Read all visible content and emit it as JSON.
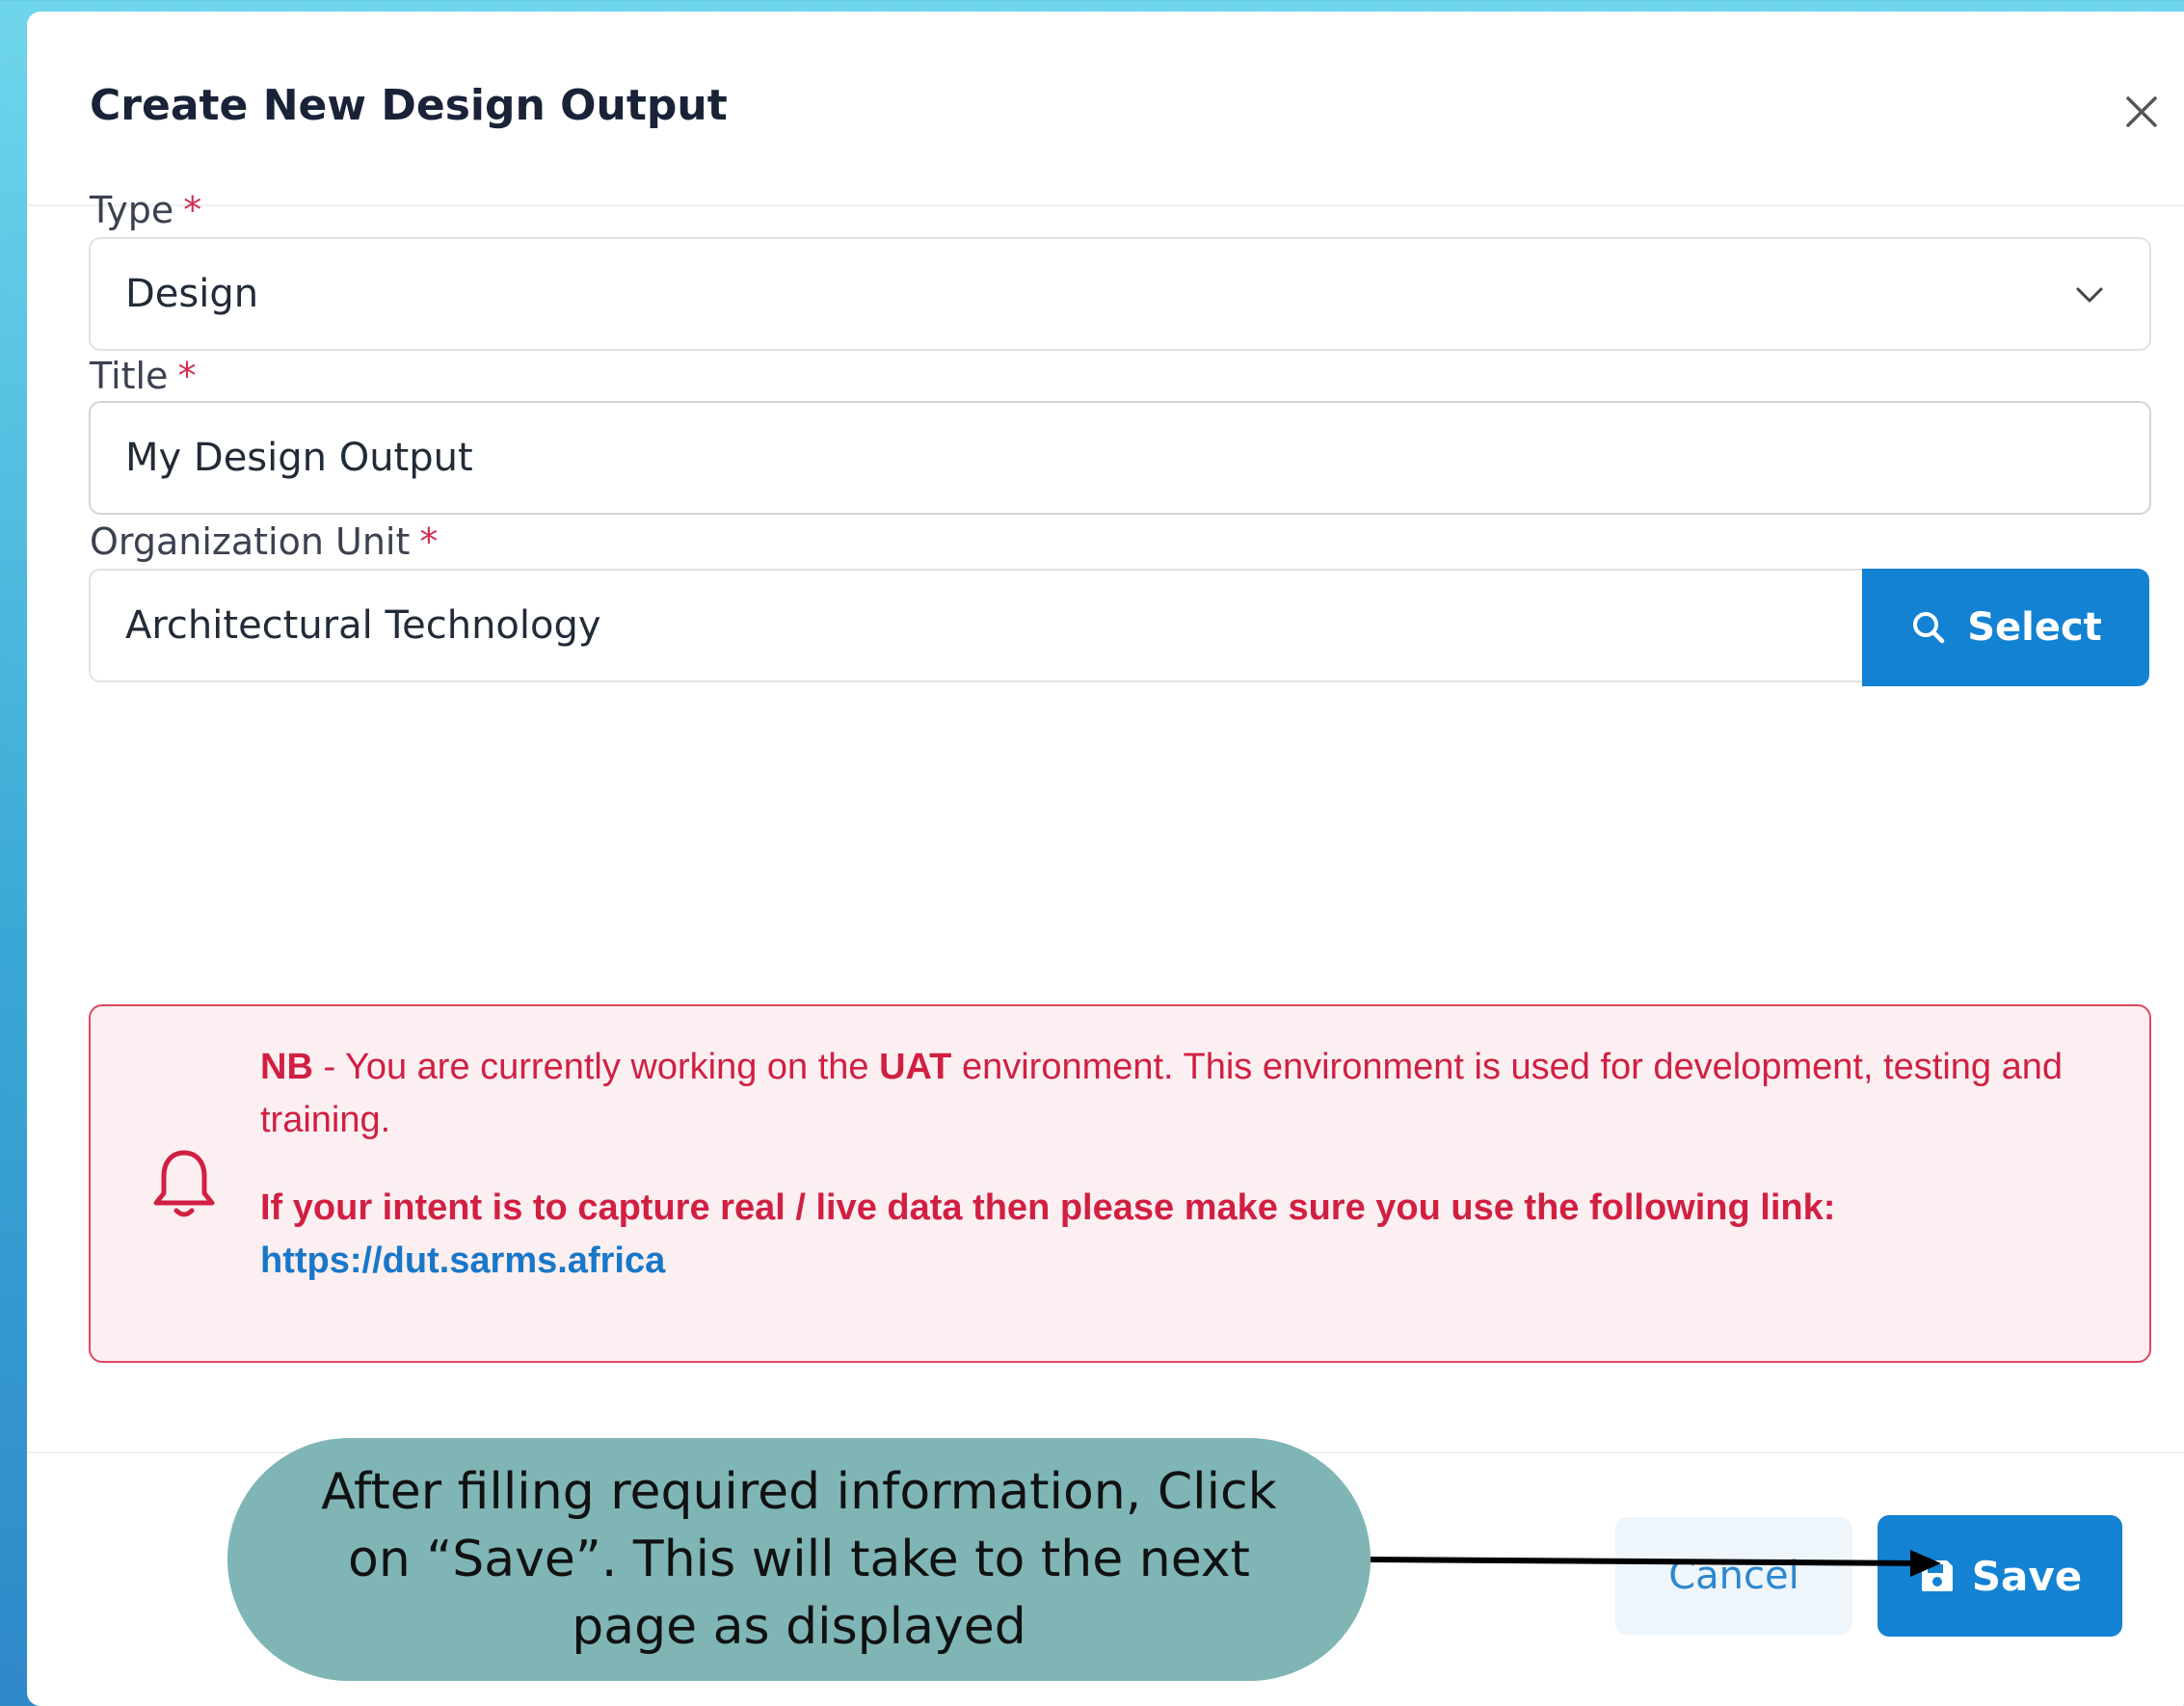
{
  "modal": {
    "title": "Create New Design Output",
    "close_icon": "close-icon"
  },
  "form": {
    "type": {
      "label": "Type",
      "required_mark": "*",
      "value": "Design"
    },
    "title": {
      "label": "Title",
      "required_mark": "*",
      "value": "My Design Output"
    },
    "org_unit": {
      "label": "Organization Unit",
      "required_mark": "*",
      "value": "Architectural Technology",
      "select_label": "Select"
    }
  },
  "alert": {
    "nb": "NB",
    "text_before_uat": " - You are currently working on the ",
    "uat": "UAT",
    "text_after_uat": " environment. This environment is used for development, testing and training.",
    "intent_text": "If your intent is to capture real / live data then please make sure you use the following link:",
    "link": "https://dut.sarms.africa"
  },
  "footer": {
    "cancel_label": "Cancel",
    "save_label": "Save"
  },
  "annotation": {
    "text": "After filling required information, Click on “Save”. This will take to the next page as displayed"
  },
  "colors": {
    "primary": "#1382d3",
    "danger": "#d11f42",
    "callout": "#7fb5b5"
  }
}
